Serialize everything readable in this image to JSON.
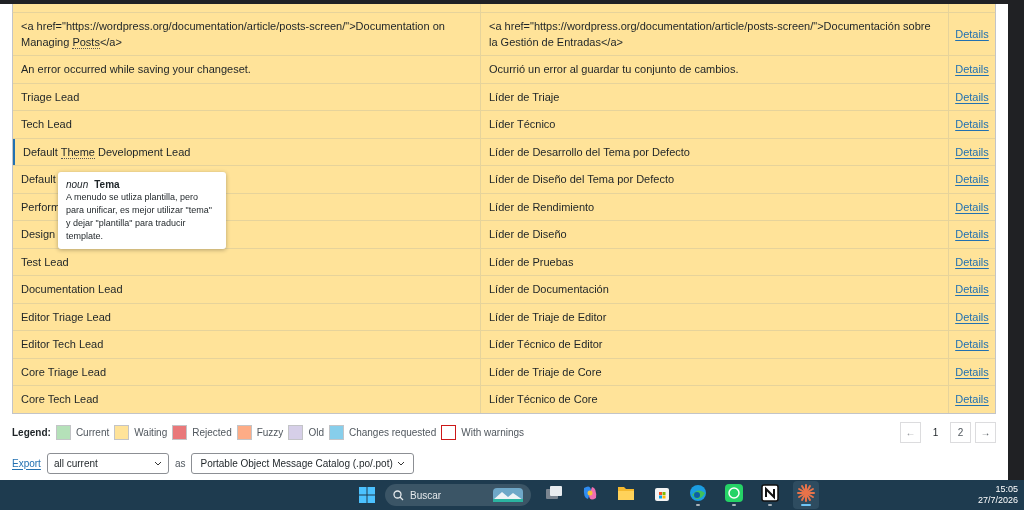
{
  "table": {
    "rows": [
      {
        "original": [
          {
            "text": "<a href=\"https://wordpress.org/documentation/article/posts-screen/\">Documentation on Managing ",
            "term": false
          },
          {
            "text": "Posts",
            "term": true
          },
          {
            "text": "</a>",
            "term": false
          }
        ],
        "translation": "<a href=\"https://wordpress.org/documentation/article/posts-screen/\">Documentación sobre la Gestión de Entradas</a>",
        "action": "Details",
        "selected": false
      },
      {
        "original": [
          {
            "text": "An error occurred while saving your changeset.",
            "term": false
          }
        ],
        "translation": "Ocurrió un error al guardar tu conjunto de cambios.",
        "action": "Details",
        "selected": false
      },
      {
        "original": [
          {
            "text": "Triage Lead",
            "term": false
          }
        ],
        "translation": "Líder de Triaje",
        "action": "Details",
        "selected": false
      },
      {
        "original": [
          {
            "text": "Tech Lead",
            "term": false
          }
        ],
        "translation": "Líder Técnico",
        "action": "Details",
        "selected": false
      },
      {
        "original": [
          {
            "text": "Default ",
            "term": false
          },
          {
            "text": "Theme",
            "term": true
          },
          {
            "text": " Development Lead",
            "term": false
          }
        ],
        "translation": "Líder de Desarrollo del Tema por Defecto",
        "action": "Details",
        "selected": true
      },
      {
        "original": [
          {
            "text": "Default",
            "term": false
          }
        ],
        "translation": "Líder de Diseño del Tema por Defecto",
        "action": "Details",
        "selected": false
      },
      {
        "original": [
          {
            "text": "Perform",
            "term": false
          }
        ],
        "translation": "Líder de Rendimiento",
        "action": "Details",
        "selected": false
      },
      {
        "original": [
          {
            "text": "Design",
            "term": false
          }
        ],
        "translation": "Líder de Diseño",
        "action": "Details",
        "selected": false
      },
      {
        "original": [
          {
            "text": "Test Lead",
            "term": false
          }
        ],
        "translation": "Líder de Pruebas",
        "action": "Details",
        "selected": false
      },
      {
        "original": [
          {
            "text": "Documentation Lead",
            "term": false
          }
        ],
        "translation": "Líder de Documentación",
        "action": "Details",
        "selected": false
      },
      {
        "original": [
          {
            "text": "Editor Triage Lead",
            "term": false
          }
        ],
        "translation": "Líder de Triaje de Editor",
        "action": "Details",
        "selected": false
      },
      {
        "original": [
          {
            "text": "Editor Tech Lead",
            "term": false
          }
        ],
        "translation": "Líder Técnico de Editor",
        "action": "Details",
        "selected": false
      },
      {
        "original": [
          {
            "text": "Core Triage Lead",
            "term": false
          }
        ],
        "translation": "Líder de Triaje de Core",
        "action": "Details",
        "selected": false
      },
      {
        "original": [
          {
            "text": "Core Tech Lead",
            "term": false
          }
        ],
        "translation": "Líder Técnico de Core",
        "action": "Details",
        "selected": false
      }
    ]
  },
  "tooltip": {
    "part_of_speech": "noun",
    "term": "Tema",
    "comment": "A menudo se utliza plantilla, pero para unificar, es mejor utilizar \"tema\" y dejar \"plantilla\" para traducir template."
  },
  "legend": {
    "label": "Legend:",
    "items": [
      {
        "label": "Current",
        "color": "#b5e1b9"
      },
      {
        "label": "Waiting",
        "color": "#ffe399"
      },
      {
        "label": "Rejected",
        "color": "#e9787a"
      },
      {
        "label": "Fuzzy",
        "color": "#fdac86"
      },
      {
        "label": "Old",
        "color": "#d6cfe8"
      },
      {
        "label": "Changes requested",
        "color": "#87ceeb"
      },
      {
        "label": "With warnings",
        "color": "#ffffff"
      }
    ]
  },
  "pagination": {
    "prev": "←",
    "next": "→",
    "pages": [
      {
        "label": "1",
        "selected": true
      },
      {
        "label": "2",
        "selected": false
      }
    ]
  },
  "export": {
    "link": "Export",
    "filter": "all current",
    "joiner": "as",
    "format": "Portable Object Message Catalog (.po/.pot)"
  },
  "taskbar": {
    "search": "Buscar",
    "apps": [
      {
        "kind": "taskview",
        "running": false,
        "active": false
      },
      {
        "kind": "copilot",
        "running": false,
        "active": false
      },
      {
        "kind": "folder",
        "running": false,
        "active": false
      },
      {
        "kind": "store",
        "running": false,
        "active": false
      },
      {
        "kind": "edge",
        "running": true,
        "active": false
      },
      {
        "kind": "whatsapp",
        "running": true,
        "active": false
      },
      {
        "kind": "notion",
        "running": true,
        "active": false
      },
      {
        "kind": "burst",
        "running": true,
        "active": true
      }
    ],
    "time": "15:05",
    "date": "27/7/2026"
  }
}
